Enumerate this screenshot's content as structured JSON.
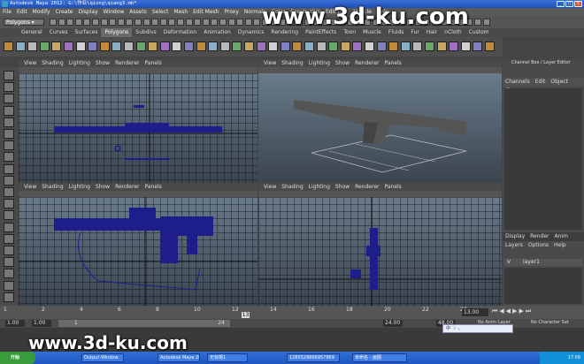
{
  "window": {
    "title": "Autodesk Maya 2012: G:\\作业\\qiong\\qiang3.mb*",
    "minimize": "_",
    "maximize": "□",
    "close": "x"
  },
  "menubar": [
    "File",
    "Edit",
    "Modify",
    "Create",
    "Display",
    "Window",
    "Assets",
    "Select",
    "Mesh",
    "Edit Mesh",
    "Proxy",
    "Normals",
    "Color",
    "Create UVs",
    "Edit UVs",
    "Muscle",
    "Help"
  ],
  "statusline": {
    "mode": "Polygons"
  },
  "shelf_tabs": [
    "General",
    "Curves",
    "Surfaces",
    "Polygons",
    "Subdivs",
    "Deformation",
    "Animation",
    "Dynamics",
    "Rendering",
    "PaintEffects",
    "Toon",
    "Muscle",
    "Fluids",
    "Fur",
    "Hair",
    "nCloth",
    "Custom"
  ],
  "shelf_active": "Polygons",
  "viewport_menu": [
    "View",
    "Shading",
    "Lighting",
    "Show",
    "Renderer",
    "Panels"
  ],
  "channel_box": {
    "title": "Channel Box / Layer Editor",
    "menu": [
      "Channels",
      "Edit",
      "Object",
      "Show"
    ]
  },
  "layer_editor": {
    "tabs": [
      "Display",
      "Render",
      "Anim"
    ],
    "menu": [
      "Layers",
      "Options",
      "Help"
    ],
    "layers": [
      {
        "visible": "V",
        "name": "layer1"
      }
    ]
  },
  "timeslider": {
    "ticks": [
      "1",
      "2",
      "4",
      "6",
      "8",
      "10",
      "12",
      "14",
      "16",
      "18",
      "20",
      "22",
      "24"
    ],
    "current_frame": "13",
    "current_time": "13.00"
  },
  "range": {
    "start": "1.00",
    "inner_start": "1.00",
    "inner_start_field": "1",
    "inner_end_field": "24",
    "end": "24.00",
    "end2": "48.00",
    "anim_layer": "No Anim Layer",
    "char_set": "No Character Set"
  },
  "watermarks": {
    "top": "www.3d-ku.com",
    "bottom": "www.3d-ku.com",
    "ime": "中 ☽ ·,"
  },
  "taskbar": {
    "start": "开始",
    "tasks": [
      "Output Window",
      "Autodesk Maya 20...",
      "无标题1",
      "1285529866957969",
      "未命名 - 画图"
    ],
    "clock": "17:09"
  }
}
